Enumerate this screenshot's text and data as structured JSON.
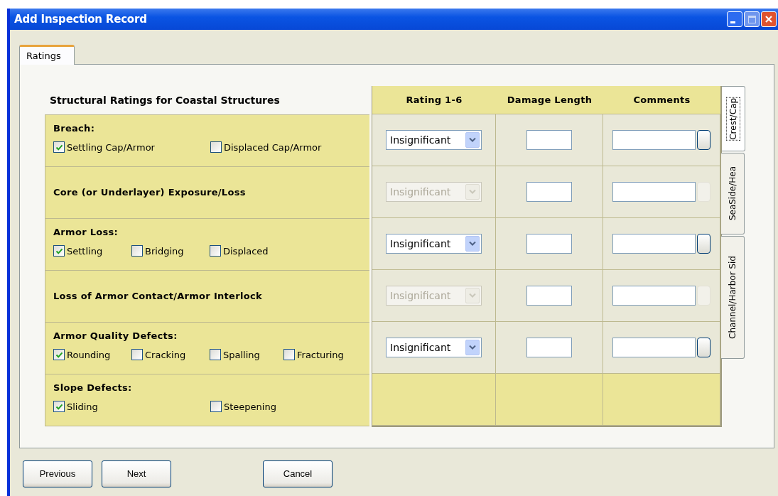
{
  "window": {
    "title": "Add Inspection Record"
  },
  "tabs": [
    {
      "label": "Ratings",
      "selected": true
    }
  ],
  "heading": "Structural Ratings for Coastal Structures",
  "columns": [
    "Rating 1-6",
    "Damage Length",
    "Comments"
  ],
  "rows": [
    {
      "kind": "options",
      "label": "Breach:",
      "options": [
        {
          "label": "Settling Cap/Armor",
          "checked": true
        },
        {
          "label": "Displaced Cap/Armor",
          "checked": false
        }
      ],
      "rating": {
        "value": "Insignificant",
        "disabled": false
      }
    },
    {
      "kind": "single",
      "label": "Core (or Underlayer) Exposure/Loss",
      "rating": {
        "value": "Insignificant",
        "disabled": true
      }
    },
    {
      "kind": "options",
      "label": "Armor Loss:",
      "options": [
        {
          "label": "Settling",
          "checked": true
        },
        {
          "label": "Bridging",
          "checked": false
        },
        {
          "label": "Displaced",
          "checked": false
        }
      ],
      "rating": {
        "value": "Insignificant",
        "disabled": false
      }
    },
    {
      "kind": "single",
      "label": "Loss of Armor Contact/Armor Interlock",
      "rating": {
        "value": "Insignificant",
        "disabled": true
      }
    },
    {
      "kind": "options",
      "label": "Armor Quality Defects:",
      "options": [
        {
          "label": "Rounding",
          "checked": true
        },
        {
          "label": "Cracking",
          "checked": false
        },
        {
          "label": "Spalling",
          "checked": false
        },
        {
          "label": "Fracturing",
          "checked": false
        }
      ],
      "rating": {
        "value": "Insignificant",
        "disabled": false
      }
    },
    {
      "kind": "options",
      "label": "Slope Defects:",
      "options": [
        {
          "label": "Sliding",
          "checked": true
        },
        {
          "label": "Steepening",
          "checked": false
        }
      ]
    }
  ],
  "side_tabs": [
    {
      "label": "Crest/Cap",
      "selected": true
    },
    {
      "label": "SeaSide/Hea",
      "selected": false
    },
    {
      "label": "Channel/Harbor Sid",
      "selected": false
    }
  ],
  "buttons": [
    "Previous",
    "Next",
    "Cancel"
  ]
}
